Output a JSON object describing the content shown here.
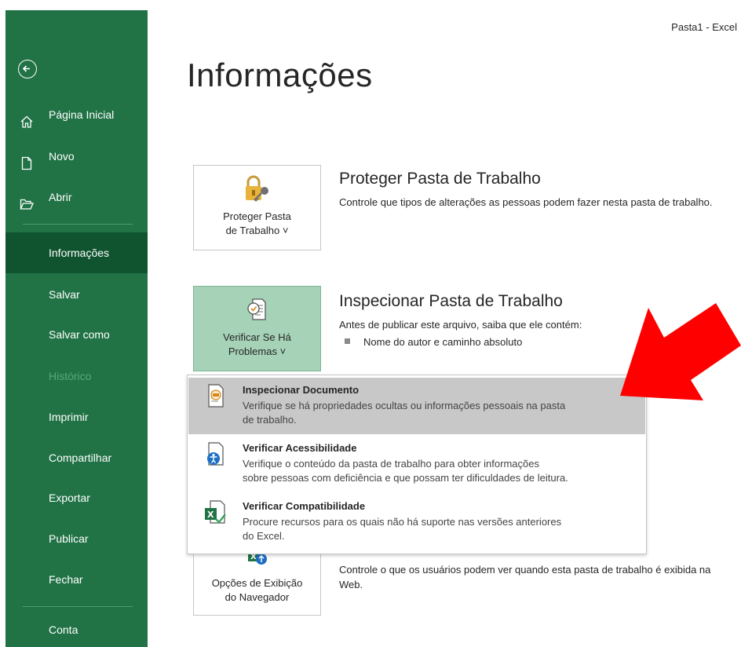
{
  "window": {
    "title": "Pasta1  -  Excel"
  },
  "sidebar": {
    "items": [
      {
        "label": "Página Inicial",
        "icon": "home-icon"
      },
      {
        "label": "Novo",
        "icon": "new-file-icon"
      },
      {
        "label": "Abrir",
        "icon": "folder-open-icon"
      },
      {
        "label": "Informações",
        "active": true
      },
      {
        "label": "Salvar"
      },
      {
        "label": "Salvar como"
      },
      {
        "label": "Histórico",
        "disabled": true
      },
      {
        "label": "Imprimir"
      },
      {
        "label": "Compartilhar"
      },
      {
        "label": "Exportar"
      },
      {
        "label": "Publicar"
      },
      {
        "label": "Fechar"
      },
      {
        "label": "Conta"
      }
    ]
  },
  "main": {
    "title": "Informações",
    "sections": [
      {
        "tile_line1": "Proteger Pasta",
        "tile_line2": "de Trabalho ˅",
        "heading": "Proteger Pasta de Trabalho",
        "description": "Controle que tipos de alterações as pessoas podem fazer nesta pasta de trabalho."
      },
      {
        "tile_line1": "Verificar Se Há",
        "tile_line2": "Problemas ˅",
        "heading": "Inspecionar Pasta de Trabalho",
        "description": "Antes de publicar este arquivo, saiba que ele contém:",
        "bullet": "Nome do autor e caminho absoluto"
      },
      {
        "tile_line1": "Opções de Exibição",
        "tile_line2": "do Navegador",
        "description": "Controle o que os usuários podem ver quando esta pasta de trabalho é exibida na Web."
      }
    ]
  },
  "dropdown": {
    "items": [
      {
        "title": "Inspecionar Documento",
        "desc_line1": "Verifique se há propriedades ocultas ou informações pessoais na pasta",
        "desc_line2": "de trabalho."
      },
      {
        "title": "Verificar Acessibilidade",
        "desc_line1": "Verifique o conteúdo da pasta de trabalho para obter informações",
        "desc_line2": "sobre pessoas com deficiência e que possam ter dificuldades de leitura."
      },
      {
        "title": "Verificar Compatibilidade",
        "desc_line1": "Procure recursos para os quais não há suporte nas versões anteriores",
        "desc_line2": "do Excel."
      }
    ]
  },
  "colors": {
    "sidebar_bg": "#217346",
    "sidebar_active": "#10542f",
    "tile_selected": "#a6d3b8",
    "hover_row": "#c8c8c8",
    "annotation_arrow": "#ff0000"
  }
}
